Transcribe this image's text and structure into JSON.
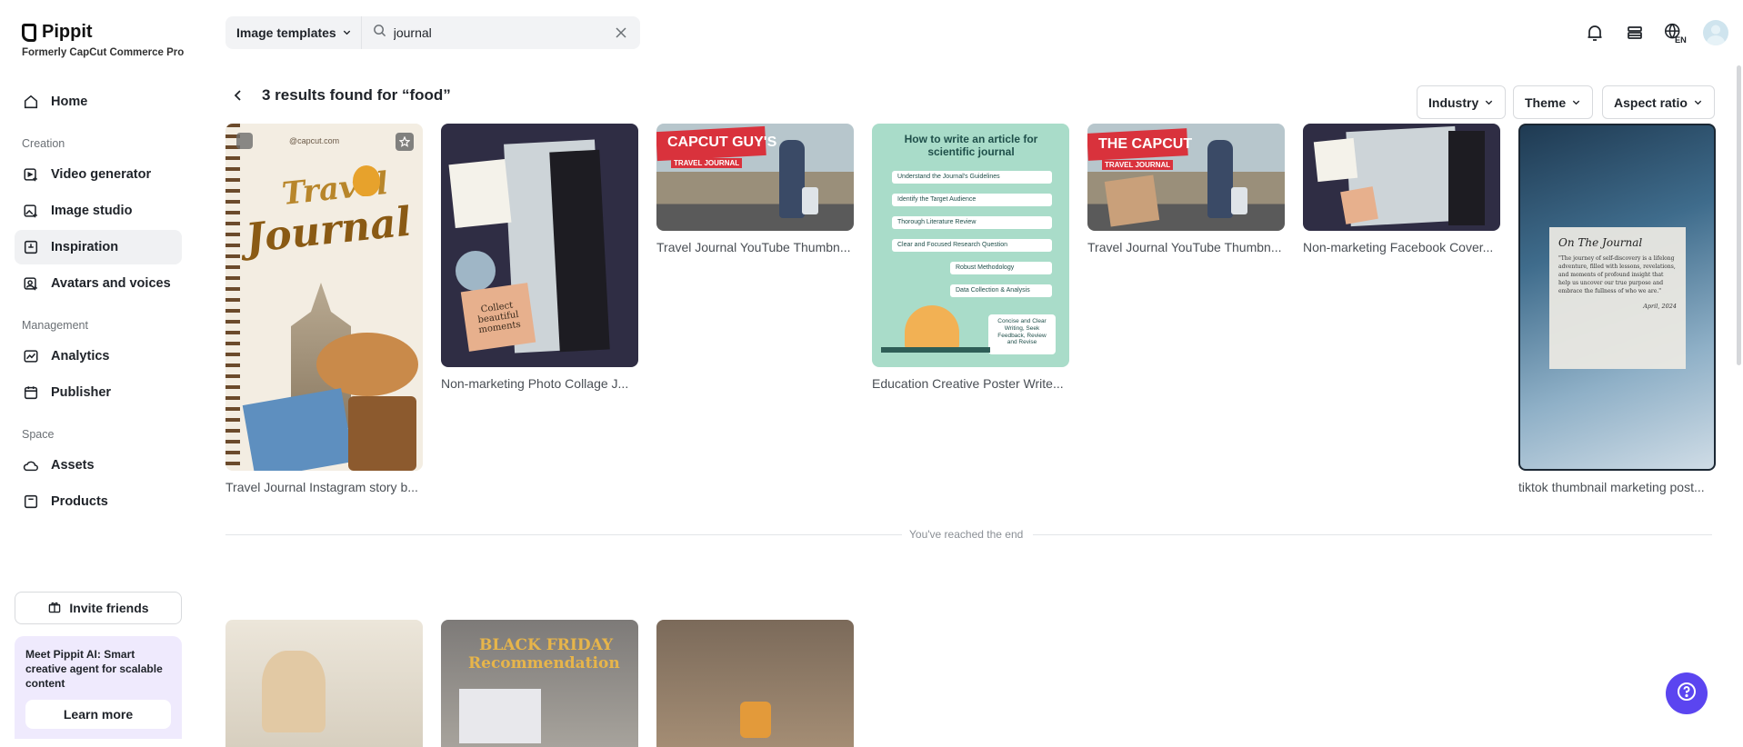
{
  "app": {
    "logo": "Pippit",
    "subtitle": "Formerly CapCut Commerce Pro"
  },
  "sidebar": {
    "items": [
      {
        "label": "Home",
        "icon": "home-icon"
      },
      {
        "label": "Video generator",
        "icon": "video-plus-icon"
      },
      {
        "label": "Image studio",
        "icon": "image-plus-icon"
      },
      {
        "label": "Inspiration",
        "icon": "bulb-icon",
        "active": true
      },
      {
        "label": "Avatars and voices",
        "icon": "avatar-plus-icon"
      },
      {
        "label": "Analytics",
        "icon": "chart-icon"
      },
      {
        "label": "Publisher",
        "icon": "calendar-icon"
      },
      {
        "label": "Assets",
        "icon": "cloud-icon"
      },
      {
        "label": "Products",
        "icon": "product-box-icon"
      }
    ],
    "sections": {
      "creation": "Creation",
      "management": "Management",
      "space": "Space"
    },
    "invite_label": "Invite friends",
    "promo_text": "Meet Pippit AI: Smart creative agent for scalable content",
    "promo_button": "Learn more"
  },
  "search": {
    "type_label": "Image templates",
    "value": "journal"
  },
  "results": {
    "title": "3 results found for “food”",
    "filters": [
      "Industry",
      "Theme",
      "Aspect ratio"
    ],
    "end_text": "You've reached the end"
  },
  "cards": [
    {
      "title": "Travel Journal Instagram story b...",
      "watermark": "@capcut.com",
      "art_line1": "Travel",
      "art_line2": "Journal"
    },
    {
      "title": "Non-marketing Photo Collage J...",
      "art_text": "Collect beautiful moments"
    },
    {
      "title": "Travel Journal YouTube Thumbn...",
      "art_line1": "CAPCUT GUY'S",
      "art_line2": "TRAVEL JOURNAL"
    },
    {
      "title": "Education Creative Poster Write...",
      "art_heading": "How to write an article for scientific journal",
      "steps": [
        "Understand the Journal's Guidelines",
        "Identify the Target Audience",
        "Thorough Literature Review",
        "Clear and Focused Research Question",
        "Robust Methodology",
        "Data Collection & Analysis"
      ],
      "callout": "Concise and Clear Writing, Seek Feedback, Review and Revise"
    },
    {
      "title": "Travel Journal YouTube Thumbn...",
      "art_line1": "THE CAPCUT",
      "art_line2": "TRAVEL JOURNAL"
    },
    {
      "title": "Non-marketing Facebook Cover..."
    },
    {
      "title": "tiktok thumbnail marketing post...",
      "art_heading": "On The Journal",
      "art_body": "\"The journey of self-discovery is a lifelong adventure, filled with lessons, revelations, and moments of profound insight that help us uncover our true purpose and embrace the fullness of who we are.\"",
      "art_date": "April, 2024"
    }
  ],
  "second_row": [
    {
      "art_text": ""
    },
    {
      "art_line1": "BLACK FRIDAY",
      "art_line2": "Recommendation"
    },
    {
      "art_text": ""
    }
  ],
  "colors": {
    "accent": "#5b45f0",
    "active_nav": "#f0f1f3",
    "promo_bg": "#efeafd"
  }
}
